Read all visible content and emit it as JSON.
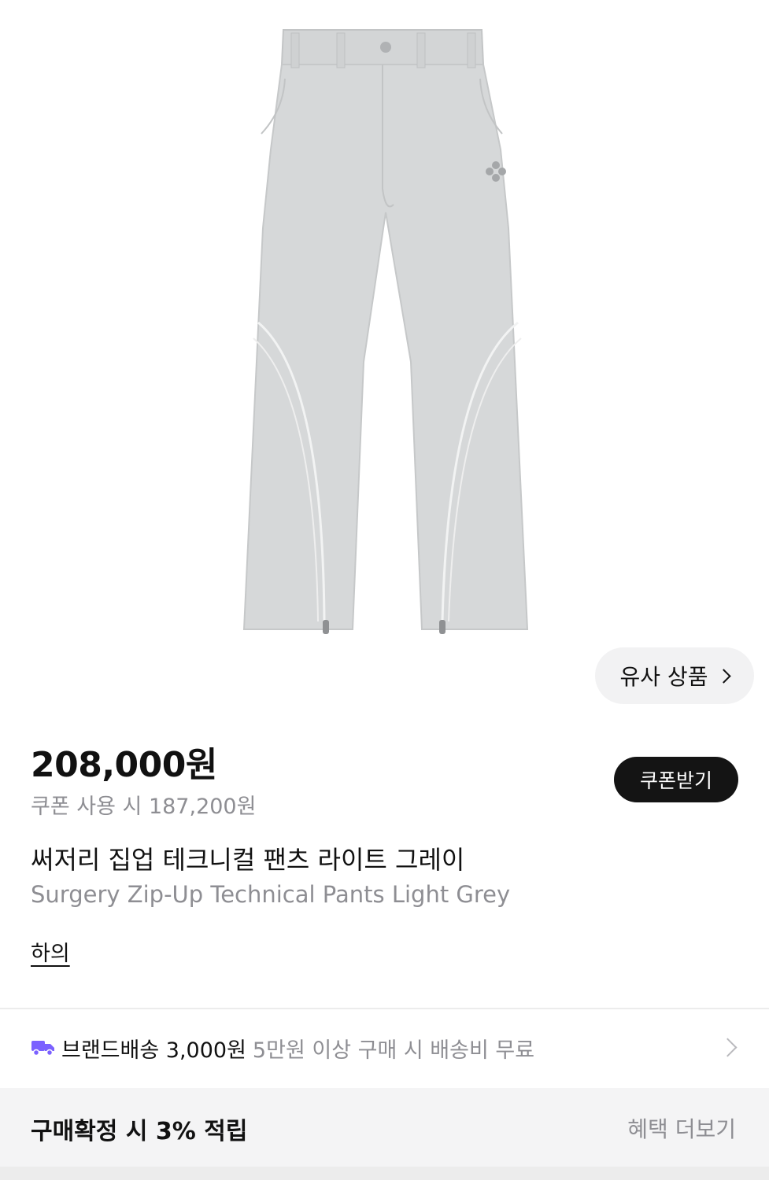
{
  "product": {
    "image_alt": "Surgery Zip-Up Technical Pants Light Grey",
    "price": "208,000원",
    "coupon_price": "쿠폰 사용 시 187,200원",
    "name_ko": "써저리 집업 테크니컬 팬츠 라이트 그레이",
    "name_en": "Surgery Zip-Up Technical Pants Light Grey",
    "category": "하의"
  },
  "buttons": {
    "similar": "유사 상품",
    "coupon": "쿠폰받기"
  },
  "shipping": {
    "label": "브랜드배송 3,000원",
    "note": "5만원 이상 구매 시 배송비 무료",
    "icon": "truck-icon",
    "icon_color": "#7b61ff"
  },
  "benefit": {
    "label": "구매확정 시 3% 적립",
    "more": "혜택 더보기"
  }
}
